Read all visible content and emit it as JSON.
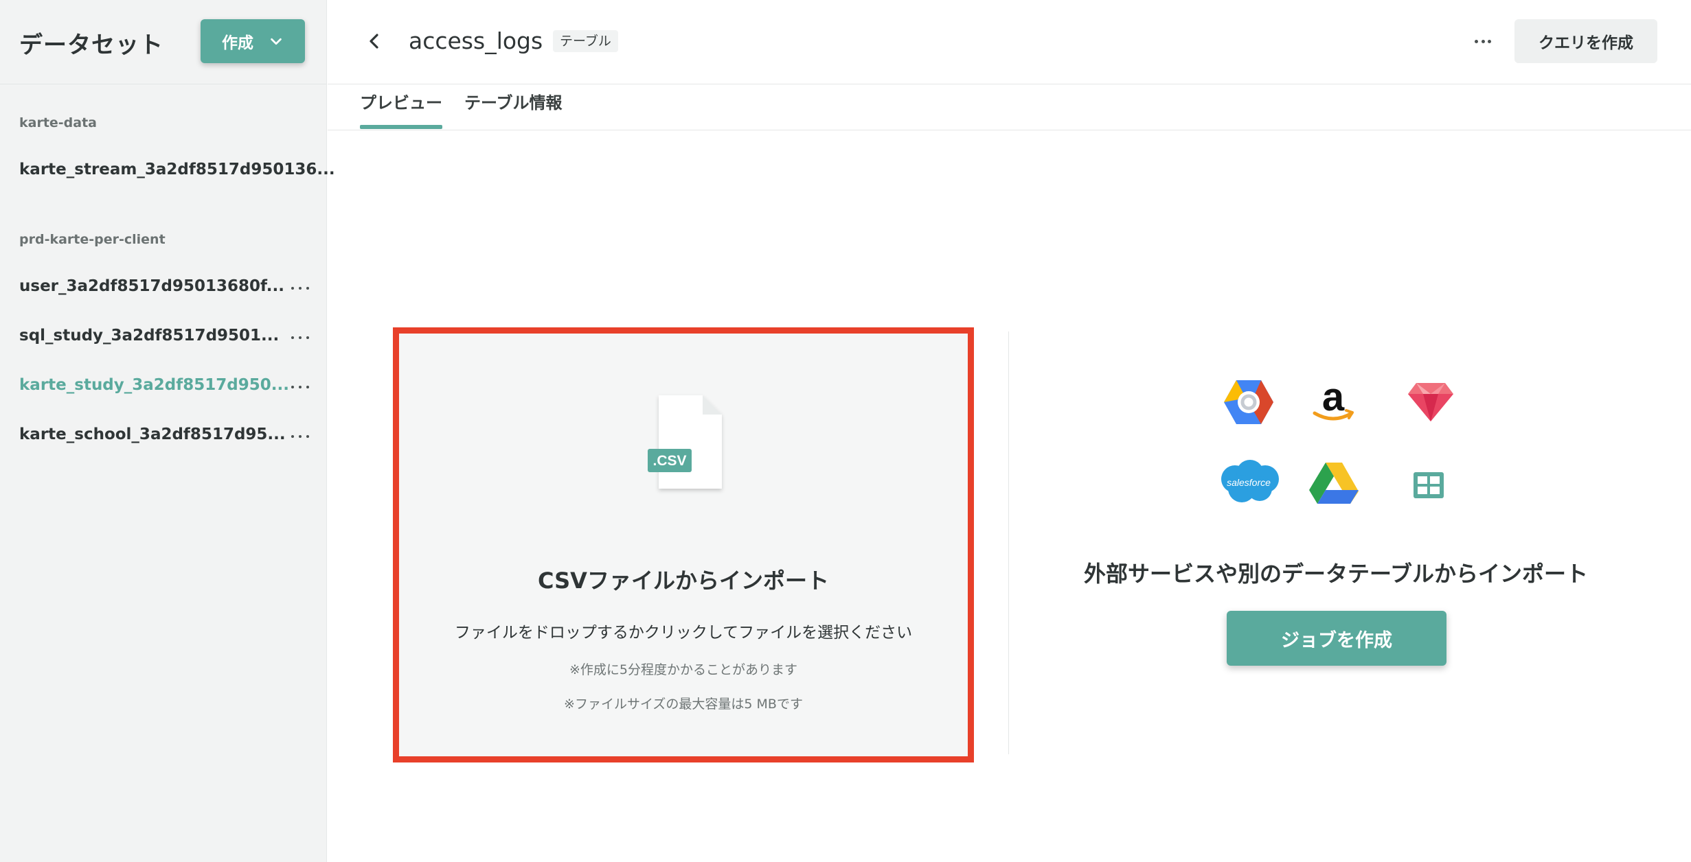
{
  "sidebar": {
    "title": "データセット",
    "create_label": "作成",
    "sections": [
      {
        "label": "karte-data",
        "items": [
          {
            "label": "karte_stream_3a2df8517d950136..."
          }
        ]
      },
      {
        "label": "prd-karte-per-client",
        "items": [
          {
            "label": "user_3a2df8517d95013680f..."
          },
          {
            "label": "sql_study_3a2df8517d9501..."
          },
          {
            "label": "karte_study_3a2df8517d950...",
            "active": true
          },
          {
            "label": "karte_school_3a2df8517d95..."
          }
        ]
      }
    ]
  },
  "header": {
    "title": "access_logs",
    "badge": "テーブル",
    "query_button": "クエリを作成"
  },
  "tabs": [
    {
      "label": "プレビュー",
      "active": true
    },
    {
      "label": "テーブル情報",
      "active": false
    }
  ],
  "csv_import": {
    "file_badge": ".CSV",
    "title": "CSVファイルからインポート",
    "description": "ファイルをドロップするかクリックしてファイルを選択ください",
    "note1": "※作成に5分程度かかることがあります",
    "note2": "※ファイルサイズの最大容量は5 MBです"
  },
  "external_import": {
    "services": [
      "google-cloud-icon",
      "amazon-icon",
      "ruby-gem-icon",
      "salesforce-icon",
      "google-drive-icon",
      "table-icon"
    ],
    "salesforce_logo_text": "salesforce",
    "title": "外部サービスや別のデータテーブルからインポート",
    "job_button": "ジョブを作成"
  },
  "colors": {
    "accent": "#5aaa9d",
    "highlight_border": "#e8402a",
    "sidebar_bg": "#f2f3f3"
  }
}
